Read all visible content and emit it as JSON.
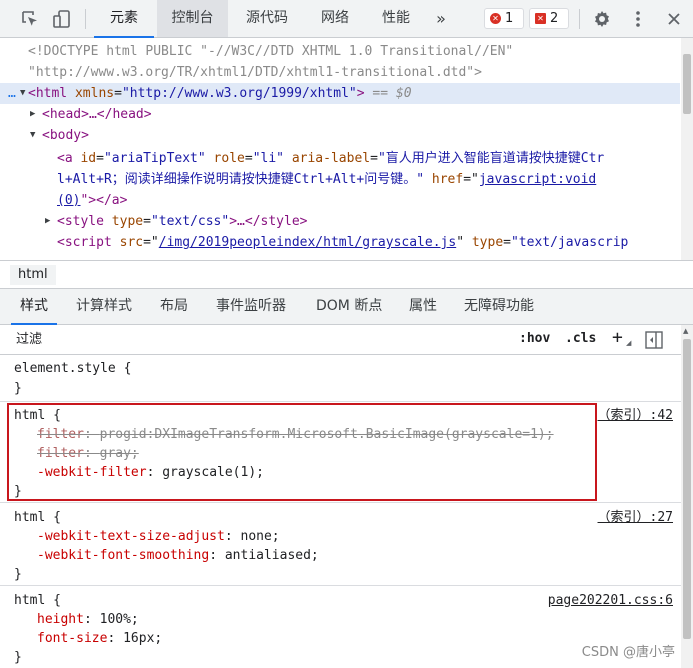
{
  "toolbar": {
    "tabs": [
      "元素",
      "控制台",
      "源代码",
      "网络",
      "性能"
    ],
    "more": "»",
    "errors": "1",
    "issues": "2",
    "icons": [
      "inspect-icon",
      "device-toggle-icon",
      "gear-icon",
      "kebab-menu-icon"
    ]
  },
  "elements": {
    "doctype_line1": "<!DOCTYPE html PUBLIC \"-//W3C//DTD XHTML 1.0 Transitional//EN\"",
    "doctype_line2": "\"http://www.w3.org/TR/xhtml1/DTD/xhtml1-transitional.dtd\">",
    "html_open_tag": "<html",
    "html_attr": "xmlns",
    "html_attr_value": "\"http://www.w3.org/1999/xhtml\"",
    "html_close": ">",
    "dollar0": "== $0",
    "head_collapsed": "<head>…</head>",
    "body_open": "<body>",
    "a_tag": "<a",
    "a_id_attr": "id",
    "a_id_val": "\"ariaTipText\"",
    "a_role_attr": "role",
    "a_role_val": "\"li\"",
    "a_label_attr": "aria-label",
    "a_label_val1": "\"盲人用户进入智能盲道请按快捷键Ctr",
    "a_label_val2": "l+Alt+R；阅读详细操作说明请按快捷键Ctrl+Alt+问号键。\"",
    "a_href_attr": "href",
    "a_href_val1": "javascript:void",
    "a_href_val2": "(0)",
    "a_close": "\"></a>",
    "style_tag": "<style",
    "style_type_attr": "type",
    "style_type_val": "\"text/css\"",
    "style_close": ">…</style>",
    "script_tag": "<script",
    "script_src_attr": "src",
    "script_src_val": "/img/2019peopleindex/html/grayscale.js",
    "script_type_attr": "type",
    "script_type_val": "\"text/javascrip"
  },
  "breadcrumb": "html",
  "subtabs": [
    "样式",
    "计算样式",
    "布局",
    "事件监听器",
    "DOM 断点",
    "属性",
    "无障碍功能"
  ],
  "filter": {
    "placeholder": "过滤",
    "hov": ":hov",
    "cls": ".cls",
    "plus": "+"
  },
  "rules": [
    {
      "selector": "element.style {",
      "close": "}",
      "decls": []
    },
    {
      "selector": "html {",
      "close": "}",
      "source": "（索引）:42",
      "decls": [
        {
          "prop": "filter",
          "value": "progid:DXImageTransform.Microsoft.BasicImage(grayscale=1);",
          "struck": true
        },
        {
          "prop": "filter",
          "value": "gray;",
          "struck": true
        },
        {
          "prop": "-webkit-filter",
          "value": "grayscale(1);",
          "struck": false
        }
      ]
    },
    {
      "selector": "html {",
      "close": "}",
      "source": "（索引）:27",
      "decls": [
        {
          "prop": "-webkit-text-size-adjust",
          "value": "none;",
          "struck": false
        },
        {
          "prop": "-webkit-font-smoothing",
          "value": "antialiased;",
          "struck": false
        }
      ]
    },
    {
      "selector": "html {",
      "close": "}",
      "source": "page202201.css:6",
      "decls": [
        {
          "prop": "height",
          "value": "100%;",
          "struck": false
        },
        {
          "prop": "font-size",
          "value": "16px;",
          "struck": false
        }
      ]
    }
  ],
  "watermark": "CSDN @唐小亭"
}
